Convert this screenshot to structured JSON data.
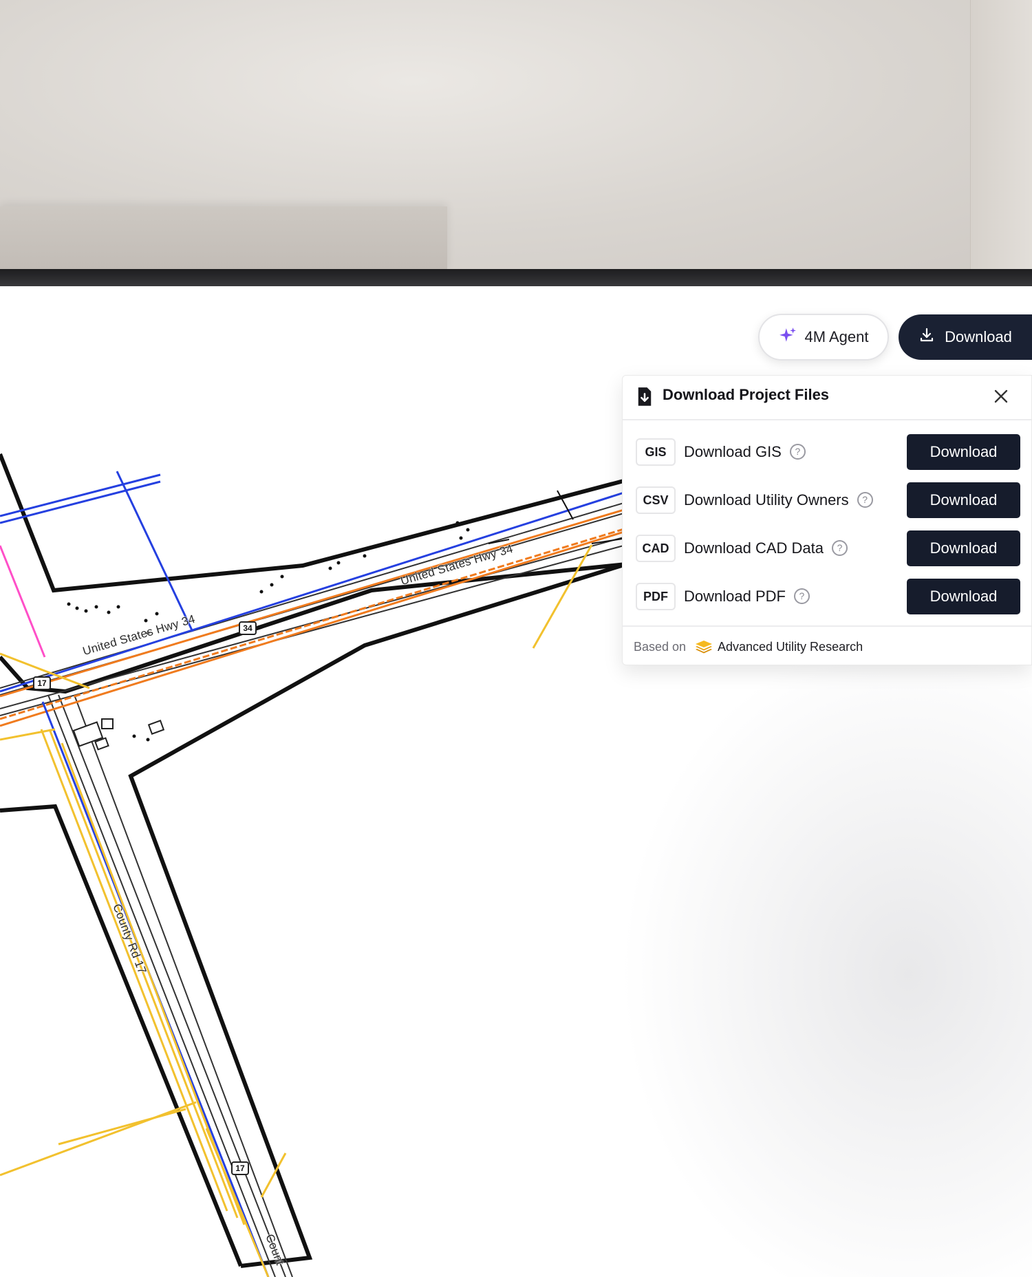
{
  "toolbar": {
    "agent_label": "4M Agent",
    "agent_icon": "sparkle-icon",
    "download_label": "Download",
    "download_icon": "download-icon"
  },
  "panel": {
    "title": "Download Project Files",
    "title_icon": "file-download-icon",
    "close_icon": "close-icon",
    "rows": [
      {
        "badge": "GIS",
        "label": "Download GIS",
        "button": "Download"
      },
      {
        "badge": "CSV",
        "label": "Download Utility Owners",
        "button": "Download"
      },
      {
        "badge": "CAD",
        "label": "Download CAD Data",
        "button": "Download"
      },
      {
        "badge": "PDF",
        "label": "Download PDF",
        "button": "Download"
      }
    ],
    "help_glyph": "?",
    "footer_prefix": "Based on",
    "footer_brand": "Advanced Utility Research",
    "footer_icon": "layers-icon"
  },
  "map": {
    "road_label_hwy": "United States Hwy 34",
    "road_label_county": "County Rd 17",
    "road_label_county_cut": "Count",
    "shield_34": "34",
    "shield_17": "17",
    "colors": {
      "road_outline": "#111111",
      "gas": "#f2c12e",
      "electric": "#f07b1e",
      "water": "#2540e0",
      "telecom": "#ff4fc8",
      "sewer": "#2aa845"
    }
  },
  "colors": {
    "primary_button": "#161c2c",
    "agent_accent": "#7a4ff0",
    "brand_accent": "#f5b91f"
  }
}
